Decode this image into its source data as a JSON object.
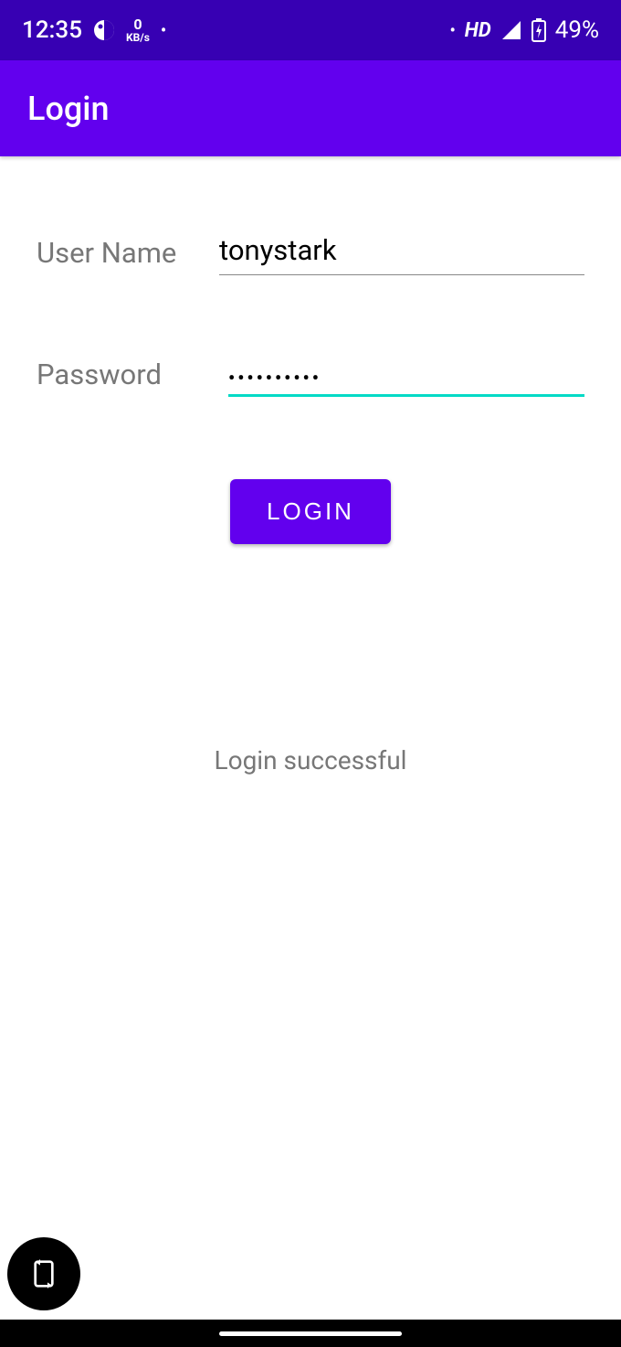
{
  "status_bar": {
    "time": "12:35",
    "kbs_value": "0",
    "kbs_unit": "KB/s",
    "hd": "HD",
    "battery_pct": "49%"
  },
  "app_bar": {
    "title": "Login"
  },
  "form": {
    "username_label": "User Name",
    "username_value": "tonystark",
    "password_label": "Password",
    "password_value": "••••••••••"
  },
  "button": {
    "login_label": "LOGIN"
  },
  "message": {
    "status": "Login successful"
  }
}
